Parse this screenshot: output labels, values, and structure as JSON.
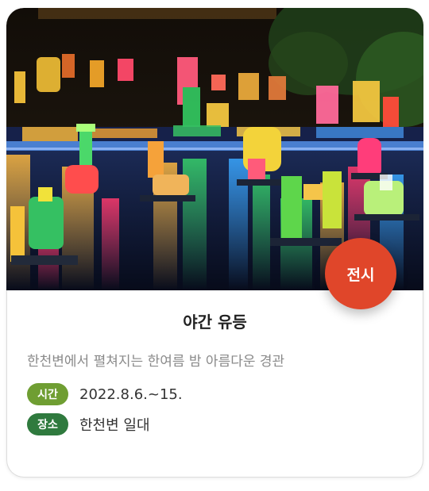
{
  "card": {
    "image": "night-lantern-lake-photo",
    "badge_label": "전시",
    "title": "야간 유등",
    "description": "한천변에서 펼쳐지는 한여름 밤 아름다운 경관",
    "time": {
      "label": "시간",
      "value": "2022.8.6.~15."
    },
    "place": {
      "label": "장소",
      "value": "한천변 일대"
    }
  },
  "colors": {
    "badge": "#e0462a",
    "time_pill": "#6f9e32",
    "place_pill": "#2f7a3e",
    "title": "#222222",
    "description": "#8a8a8a"
  }
}
